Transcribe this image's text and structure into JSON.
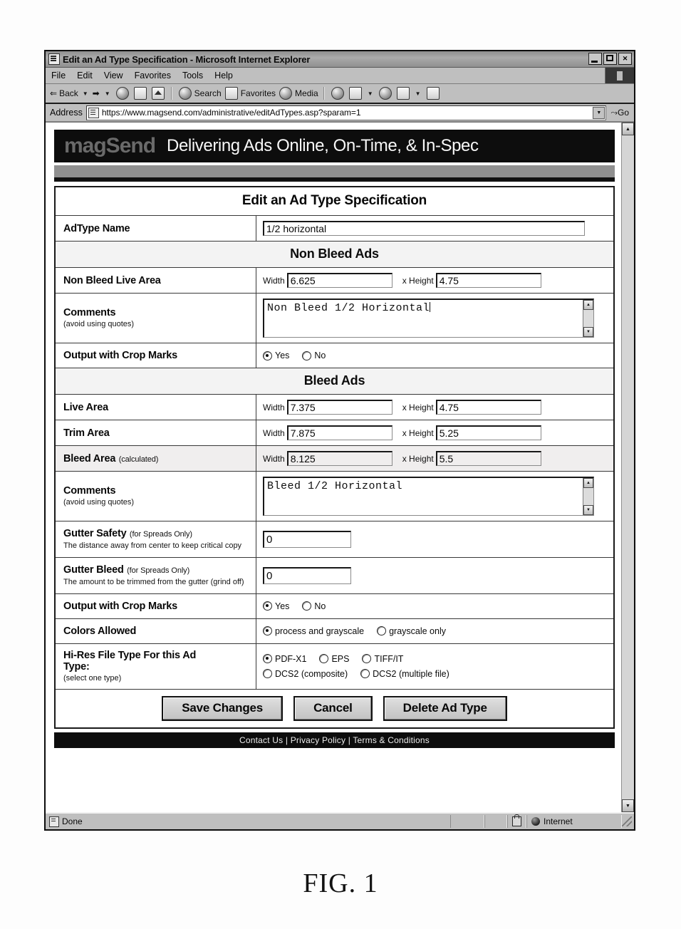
{
  "browser": {
    "title": "Edit an Ad Type Specification - Microsoft Internet Explorer",
    "window_buttons": {
      "minimize": "_",
      "maximize": "□",
      "close": "✕"
    },
    "menu": [
      "File",
      "Edit",
      "View",
      "Favorites",
      "Tools",
      "Help"
    ],
    "toolbar": {
      "back": "Back",
      "forward": "",
      "stop_icon": "stop-icon",
      "refresh_icon": "refresh-icon",
      "home_icon": "home-icon",
      "search": "Search",
      "favorites": "Favorites",
      "media": "Media",
      "history_icon": "history-icon",
      "mail_icon": "mail-icon",
      "print_icon": "print-icon",
      "edit_icon": "edit-icon",
      "discuss_icon": "discuss-icon"
    },
    "address": {
      "label": "Address",
      "url": "https://www.magsend.com/administrative/editAdTypes.asp?sparam=1",
      "go": "Go"
    },
    "status": {
      "text": "Done",
      "zone": "Internet"
    }
  },
  "banner": {
    "logo": "magSend",
    "tagline": "Delivering Ads Online, On-Time, & In-Spec"
  },
  "form": {
    "page_title": "Edit an Ad Type Specification",
    "adtype_name_label": "AdType Name",
    "adtype_name_value": "1/2 horizontal",
    "non_bleed_header": "Non Bleed Ads",
    "non_bleed_live_area_label": "Non Bleed Live Area",
    "non_bleed_live_area_width_cap": "Width",
    "non_bleed_live_area_width": "6.625",
    "non_bleed_live_area_height_cap": "x Height",
    "non_bleed_live_area_height": "4.75",
    "comments_label": "Comments",
    "comments_note": "(avoid using quotes)",
    "non_bleed_comments": "Non Bleed 1/2 Horizontal",
    "crop_marks_label_1": "Output with Crop Marks",
    "crop_marks_yes": "Yes",
    "crop_marks_no": "No",
    "crop_marks_selected_1": "Yes",
    "bleed_header": "Bleed Ads",
    "live_area_label": "Live Area",
    "live_area_width_cap": "Width",
    "live_area_width": "7.375",
    "live_area_height_cap": "x Height",
    "live_area_height": "4.75",
    "trim_area_label": "Trim Area",
    "trim_area_width_cap": "Width",
    "trim_area_width": "7.875",
    "trim_area_height_cap": "x Height",
    "trim_area_height": "5.25",
    "bleed_area_label": "Bleed Area",
    "bleed_area_sub": "(calculated)",
    "bleed_area_width_cap": "Width",
    "bleed_area_width": "8.125",
    "bleed_area_height_cap": "x Height",
    "bleed_area_height": "5.5",
    "bleed_comments": "Bleed 1/2 Horizontal",
    "gutter_safety_label": "Gutter Safety",
    "gutter_safety_sub": "(for Spreads Only)",
    "gutter_safety_note": "The distance away from center to keep critical copy",
    "gutter_safety_value": "0",
    "gutter_bleed_label": "Gutter Bleed",
    "gutter_bleed_sub": "(for Spreads Only)",
    "gutter_bleed_note": "The amount to be trimmed from the gutter (grind off)",
    "gutter_bleed_value": "0",
    "crop_marks_label_2": "Output with Crop Marks",
    "crop_marks_selected_2": "Yes",
    "colors_allowed_label": "Colors Allowed",
    "colors_option_1": "process and grayscale",
    "colors_option_2": "grayscale only",
    "colors_selected": "process and grayscale",
    "hires_label_line1": "Hi-Res File Type For this Ad",
    "hires_label_line2": "Type:",
    "hires_note": "(select one type)",
    "hires_options_row1": [
      "PDF-X1",
      "EPS",
      "TIFF/IT"
    ],
    "hires_options_row2": [
      "DCS2 (composite)",
      "DCS2 (multiple file)"
    ],
    "hires_selected": "PDF-X1",
    "buttons": {
      "save": "Save Changes",
      "cancel": "Cancel",
      "delete": "Delete Ad Type"
    }
  },
  "footer": {
    "links": "Contact Us  |  Privacy Policy  |  Terms & Conditions"
  },
  "figure": {
    "caption": "FIG. 1"
  }
}
